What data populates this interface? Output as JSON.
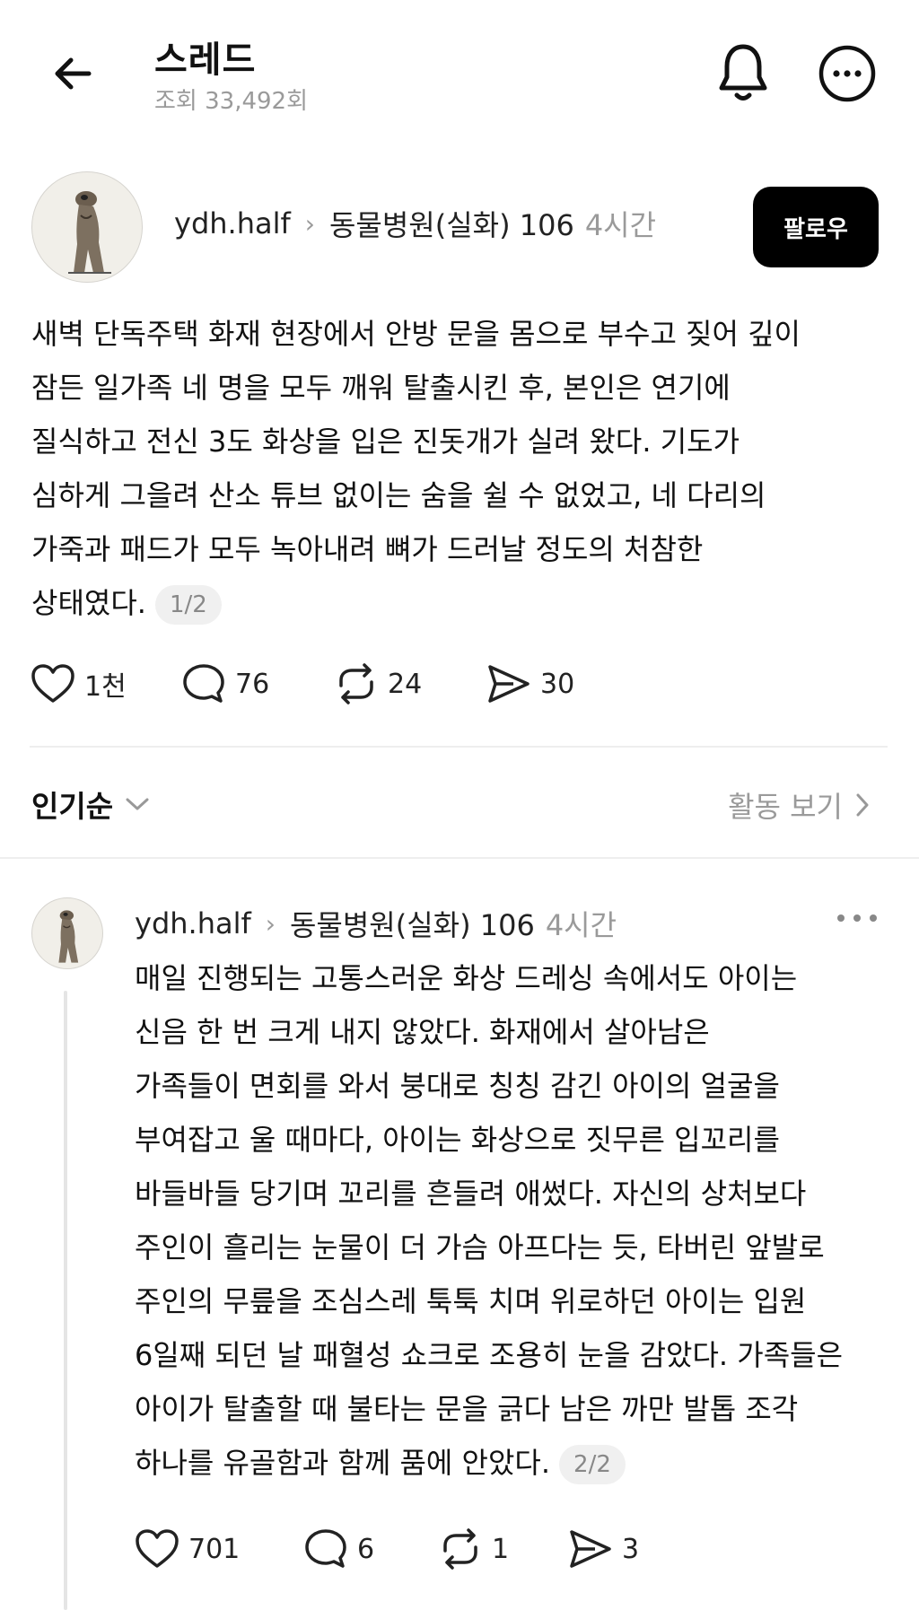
{
  "header": {
    "title": "스레드",
    "views": "조회 33,492회"
  },
  "post": {
    "username": "ydh.half",
    "topic": "동물병원(실화) 106",
    "time": "4시간",
    "follow_label": "팔로우",
    "lines": [
      "새벽 단독주택 화재 현장에서 안방 문을 몸으로 부수고 짖어 깊이",
      "잠든 일가족 네 명을 모두 깨워 탈출시킨 후, 본인은 연기에",
      "질식하고 전신 3도 화상을 입은 진돗개가 실려 왔다. 기도가",
      "심하게 그을려 산소 튜브 없이는 숨을 쉴 수 없었고, 네 다리의",
      "가죽과 패드가 모두 녹아내려 뼈가 드러날 정도의 처참한",
      "상태였다."
    ],
    "pager": "1/2",
    "likes": "1천",
    "comments": "76",
    "reposts": "24",
    "shares": "30"
  },
  "sort": {
    "label": "인기순",
    "activity_label": "활동 보기"
  },
  "reply": {
    "username": "ydh.half",
    "topic": "동물병원(실화) 106",
    "time": "4시간",
    "lines": [
      "매일 진행되는 고통스러운 화상 드레싱 속에서도 아이는",
      "신음 한 번 크게 내지 않았다. 화재에서 살아남은",
      "가족들이 면회를 와서 붕대로 칭칭 감긴 아이의 얼굴을",
      "부여잡고 울 때마다, 아이는 화상으로 짓무른 입꼬리를",
      "바들바들 당기며 꼬리를 흔들려 애썼다. 자신의 상처보다",
      "주인이 흘리는 눈물이 더 가슴 아프다는 듯, 타버린 앞발로",
      "주인의 무릎을 조심스레 툭툭 치며 위로하던 아이는 입원",
      "6일째 되던 날 패혈성 쇼크로 조용히 눈을 감았다. 가족들은",
      "아이가 탈출할 때 불타는 문을 긁다 남은 까만 발톱 조각",
      "하나를 유골함과 함께 품에 안았다."
    ],
    "pager": "2/2",
    "likes": "701",
    "comments": "6",
    "reposts": "1",
    "shares": "3"
  },
  "icons": {
    "back": "arrow-left-icon",
    "bell": "bell-icon",
    "more": "more-horizontal-icon",
    "like": "heart-icon",
    "comment": "comment-bubble-icon",
    "repost": "repost-icon",
    "share": "send-icon"
  }
}
